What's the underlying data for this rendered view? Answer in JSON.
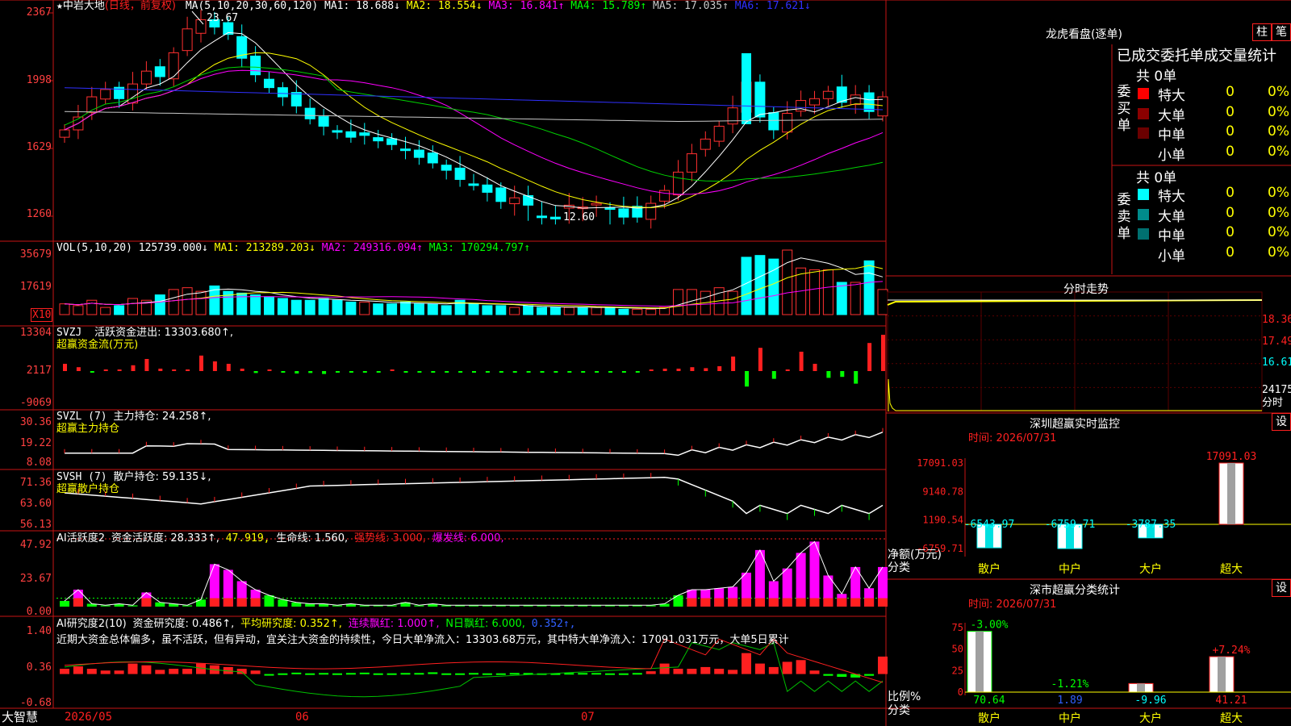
{
  "stock": {
    "star": "★",
    "name": "中岩大地",
    "period": "(日线，前复权)"
  },
  "ma_header": {
    "label": "MA(5,10,20,30,60,120)",
    "items": [
      {
        "text": "MA1: 18.688↓",
        "color": "#ffffff"
      },
      {
        "text": "MA2: 18.554↓",
        "color": "#ffff00"
      },
      {
        "text": "MA3: 16.841↑",
        "color": "#ff00ff"
      },
      {
        "text": "MA4: 15.789↑",
        "color": "#00ff00"
      },
      {
        "text": "MA5: 17.035↑",
        "color": "#c8c8c8"
      },
      {
        "text": "MA6: 17.621↓",
        "color": "#3030ff"
      }
    ]
  },
  "price_axis": [
    "2367",
    "1998",
    "1629",
    "1260"
  ],
  "price_marks": {
    "high": "23.67",
    "low": "12.60"
  },
  "vol_header": {
    "label": "VOL(5,10,20)",
    "value": "125739.000↓",
    "ma1": "MA1: 213289.203↓",
    "ma2": "MA2: 249316.094↑",
    "ma3": "MA3: 170294.797↑"
  },
  "vol_axis": [
    "35679",
    "17619"
  ],
  "vol_unit": "X10",
  "svzj": {
    "label": "SVZJ",
    "title": "活跃资金进出: 13303.680↑,",
    "subtitle": "超赢资金流(万元)",
    "axis": [
      "13304",
      "2117",
      "-9069"
    ]
  },
  "svzl": {
    "label": "SVZL (7)",
    "title": "主力持仓: 24.258↑,",
    "subtitle": "超赢主力持仓",
    "axis": [
      "30.36",
      "19.22",
      "8.08"
    ]
  },
  "svsh": {
    "label": "SVSH (7)",
    "title": "散户持仓: 59.135↓,",
    "subtitle": "超赢散户持仓",
    "axis": [
      "71.36",
      "63.60",
      "56.13"
    ]
  },
  "ai_active": {
    "label": "AI活跃度2",
    "title": "资金活跃度: 28.333↑,",
    "v2": "47.919,",
    "v3": "生命线: 1.560,",
    "v4": "强势线: 3.000,",
    "v5": "爆发线: 6.000,",
    "axis": [
      "47.92",
      "23.67",
      "0.00"
    ]
  },
  "ai_research": {
    "label": "AI研究度2(10)",
    "title": "资金研究度: 0.486↑,",
    "avg": "平均研究度: 0.352↑,",
    "red": "连续飘红: 1.000↑,",
    "nred": "N日飘红: 6.000,",
    "v5": "0.352↑,",
    "comment": "近期大资金总体偏多，虽不活跃，但有异动，宜关注大资金的持续性，今日大单净流入：13303.68万元，其中特大单净流入：17091.031万元，大单5日累计",
    "axis": [
      "1.40",
      "0.36",
      "-0.68"
    ]
  },
  "date_axis": [
    "2026/05",
    "06",
    "07"
  ],
  "brand": "大智慧",
  "dragon": {
    "title": "龙虎看盘(逐单)",
    "btn_a": "柱",
    "btn_b": "笔",
    "cols": "已成交委托单成交量统计",
    "buy": {
      "side": "委买单",
      "total": "共 0单",
      "rows": [
        {
          "name": "特大",
          "val": "0",
          "pct": "0%",
          "color": "#ff0000"
        },
        {
          "name": "大单",
          "val": "0",
          "pct": "0%",
          "color": "#8b0000"
        },
        {
          "name": "中单",
          "val": "0",
          "pct": "0%",
          "color": "#6b0000"
        },
        {
          "name": "小单",
          "val": "0",
          "pct": "0%",
          "color": "#000000"
        }
      ]
    },
    "sell": {
      "side": "委卖单",
      "total": "共 0单",
      "rows": [
        {
          "name": "特大",
          "val": "0",
          "pct": "0%",
          "color": "#00ffff"
        },
        {
          "name": "大单",
          "val": "0",
          "pct": "0%",
          "color": "#008b8b"
        },
        {
          "name": "中单",
          "val": "0",
          "pct": "0%",
          "color": "#007070"
        },
        {
          "name": "小单",
          "val": "0",
          "pct": "0%",
          "color": "#000000"
        }
      ]
    }
  },
  "intraday": {
    "title": "分时走势",
    "axis": [
      "18.36",
      "17.49",
      "16.61"
    ],
    "vol": "24175",
    "vol_lbl": "分时"
  },
  "sz_monitor": {
    "title": "深圳超赢实时监控",
    "btn": "设",
    "time": "时间: 2026/07/31",
    "axis": [
      "17091.03",
      "9140.78",
      "1190.54",
      "-6759.71"
    ],
    "side_lbl": "净额(万元)",
    "side_lbl2": "分类",
    "cats": [
      "散户",
      "中户",
      "大户",
      "超大"
    ],
    "values": [
      -6543.97,
      -6759.71,
      -3787.35,
      17091.03
    ],
    "labels": [
      "-6543.97",
      "-6759.71",
      "-3787.35",
      "17091.03"
    ]
  },
  "sz_class": {
    "title": "深市超赢分类统计",
    "btn": "设",
    "time": "时间: 2026/07/31",
    "axis": [
      "75",
      "50",
      "25",
      "0"
    ],
    "side_lbl": "比例%",
    "side_lbl2": "分类",
    "cats": [
      "散户",
      "中户",
      "大户",
      "超大"
    ],
    "chg": [
      "-3.00%",
      "-1.21%",
      "",
      "+7.24%"
    ],
    "values": [
      70.64,
      1.89,
      9.96,
      41.21
    ],
    "labels": [
      "70.64",
      "1.89",
      "-9.96",
      "41.21"
    ]
  }
}
